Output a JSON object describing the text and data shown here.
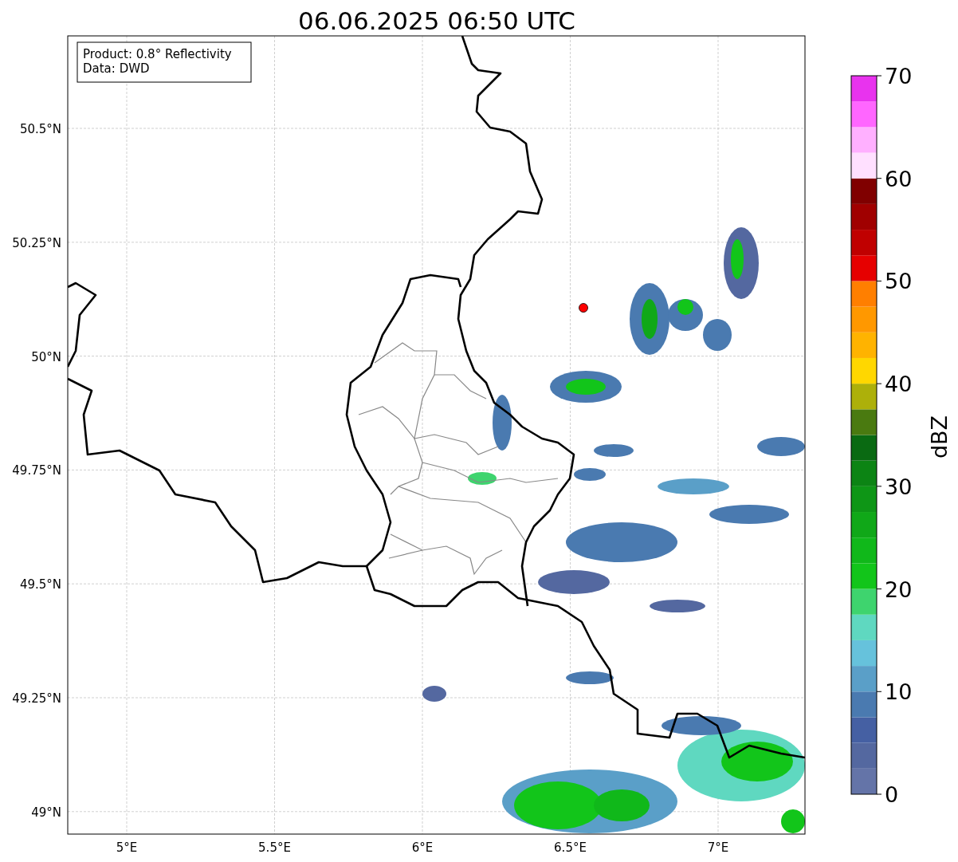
{
  "title": "06.06.2025 06:50 UTC",
  "info_box": [
    "Product: 0.8° Reflectivity",
    "Data: DWD"
  ],
  "map": {
    "lat_labels": [
      "50.5°N",
      "50.25°N",
      "50°N",
      "49.75°N",
      "49.5°N",
      "49.25°N",
      "49°N"
    ],
    "lon_labels": [
      "5°E",
      "5.5°E",
      "6°E",
      "6.5°E",
      "7°E"
    ]
  },
  "colorbar": {
    "label": "dBZ",
    "ticks": [
      "70",
      "60",
      "50",
      "40",
      "30",
      "20",
      "10",
      "0"
    ]
  }
}
